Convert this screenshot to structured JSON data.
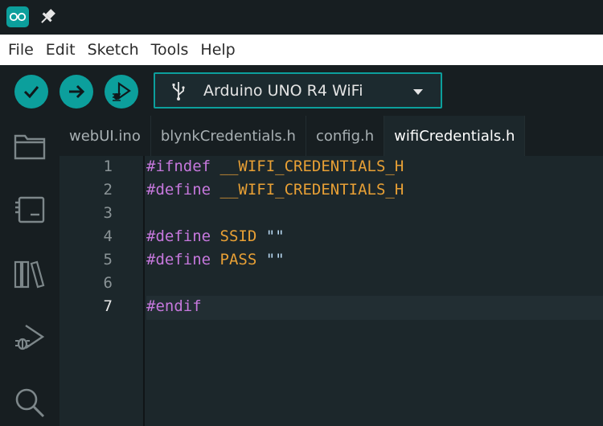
{
  "menu": [
    "File",
    "Edit",
    "Sketch",
    "Tools",
    "Help"
  ],
  "board": {
    "selected": "Arduino UNO R4 WiFi"
  },
  "tabs": [
    "webUI.ino",
    "blynkCredentials.h",
    "config.h",
    "wifiCredentials.h"
  ],
  "active_tab": "wifiCredentials.h",
  "editor": {
    "line_numbers": [
      "1",
      "2",
      "3",
      "4",
      "5",
      "6",
      "7"
    ],
    "current_line": "7",
    "lines": [
      {
        "directive": "#ifndef",
        "arg": "__WIFI_CREDENTIALS_H",
        "value": ""
      },
      {
        "directive": "#define",
        "arg": "__WIFI_CREDENTIALS_H",
        "value": ""
      },
      {
        "directive": "",
        "arg": "",
        "value": ""
      },
      {
        "directive": "#define",
        "arg": "SSID",
        "value": "\"\""
      },
      {
        "directive": "#define",
        "arg": "PASS",
        "value": "\"\""
      },
      {
        "directive": "",
        "arg": "",
        "value": ""
      },
      {
        "directive": "#endif",
        "arg": "",
        "value": ""
      }
    ]
  },
  "colors": {
    "accent": "#0c9f9c",
    "directive": "#c678dd",
    "macro": "#e8a035",
    "string": "#b7d7f0"
  },
  "icons": {
    "app": "arduino-logo-icon",
    "pin": "pin-icon",
    "verify": "checkmark-icon",
    "upload": "arrow-right-icon",
    "debug": "debug-icon",
    "usb": "usb-icon",
    "sidebar": [
      "folder-icon",
      "board-manager-icon",
      "library-icon",
      "debug-icon",
      "search-icon"
    ]
  }
}
